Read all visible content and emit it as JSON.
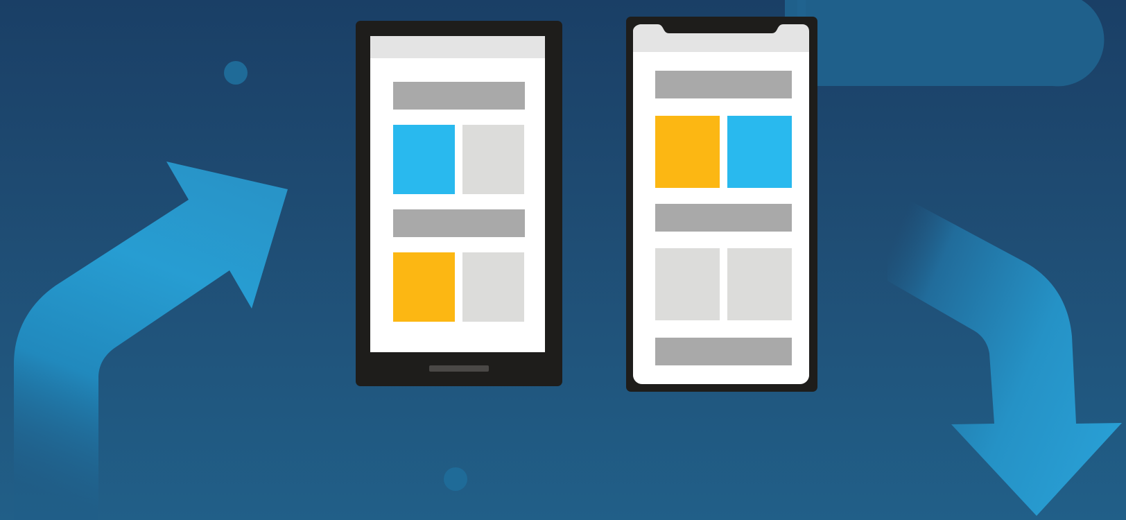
{
  "illustration": {
    "background_top": "#1a3f66",
    "background_bottom": "#215f88",
    "accent_blue": "#29b9ee",
    "accent_yellow": "#fcb713",
    "placeholder_bar": "#a9a9a9",
    "placeholder_tile": "#dcdcda",
    "device_frame": "#1e1d1b",
    "arrows": [
      "arrow-up-right-icon",
      "arrow-down-right-icon"
    ],
    "phones": [
      {
        "style": "classic-home-button",
        "tile_colors": [
          "blue",
          "grey",
          "yellow",
          "grey"
        ]
      },
      {
        "style": "notched-bezel-less",
        "tile_colors": [
          "yellow",
          "blue",
          "grey",
          "grey"
        ]
      }
    ]
  }
}
